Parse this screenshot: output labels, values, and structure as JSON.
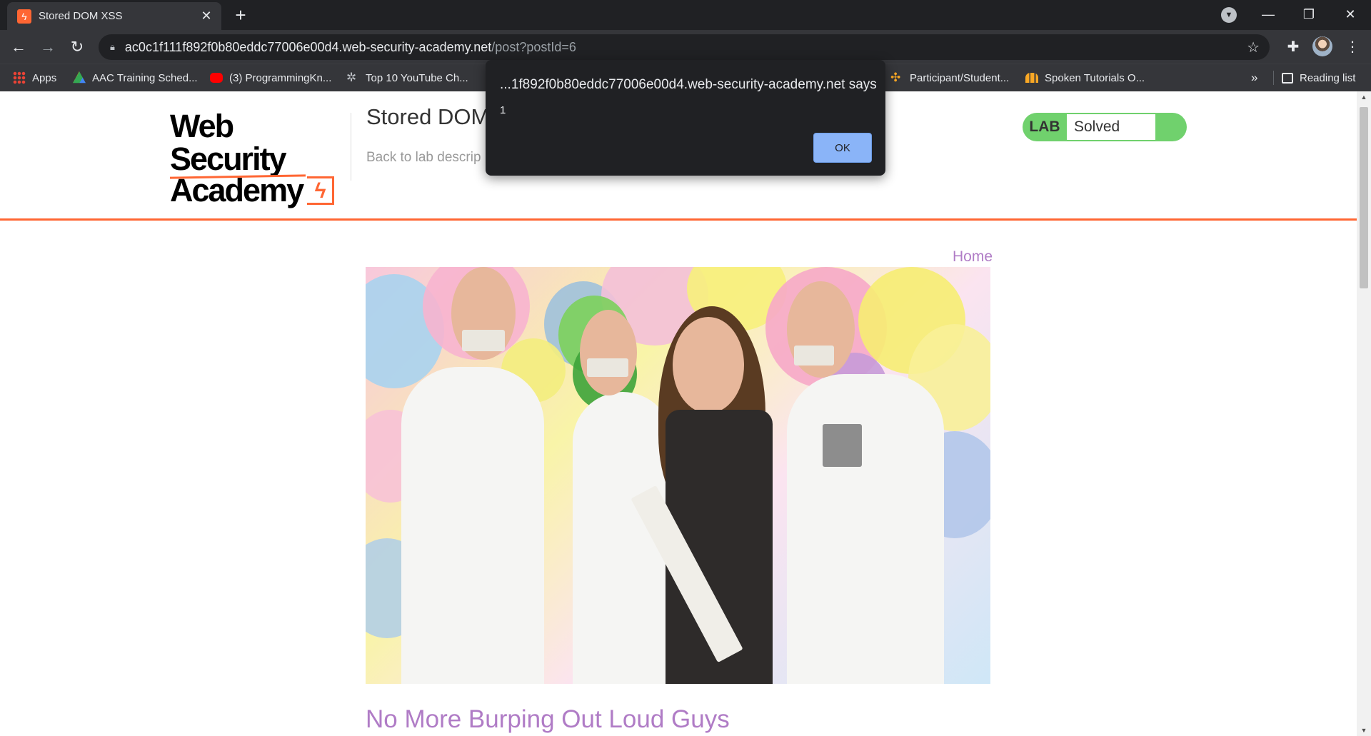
{
  "browser": {
    "tab": {
      "title": "Stored DOM XSS",
      "favicon": "lightning-icon"
    },
    "url": {
      "host": "ac0c1f111f892f0b80eddc77006e00d4.web-security-academy.net",
      "path": "/post?postId=6"
    },
    "bookmarks": [
      {
        "label": "Apps",
        "icon": "apps-grid-icon"
      },
      {
        "label": "AAC Training Sched...",
        "icon": "google-drive-icon"
      },
      {
        "label": "(3) ProgrammingKn...",
        "icon": "youtube-icon"
      },
      {
        "label": "Top 10 YouTube Ch...",
        "icon": "gear-icon"
      },
      {
        "label": "Participant/Student...",
        "icon": "pinwheel-icon"
      },
      {
        "label": "Spoken Tutorials O...",
        "icon": "spoken-tutorial-icon"
      }
    ],
    "bookmarks_more": "»",
    "reading_list": "Reading list"
  },
  "page": {
    "logo": {
      "line1": "Web Security",
      "line2": "Academy"
    },
    "lab_title": "Stored DOM",
    "back_link": "Back to lab descrip",
    "lab_status": {
      "label": "LAB",
      "value": "Solved",
      "color": "#70d16d"
    },
    "home_link": "Home",
    "post_title": "No More Burping Out Loud Guys",
    "accent_color": "#ff6633",
    "link_color": "#b07cc6"
  },
  "dialog": {
    "title": "...1f892f0b80eddc77006e00d4.web-security-academy.net says",
    "message": "1",
    "ok_label": "OK"
  }
}
